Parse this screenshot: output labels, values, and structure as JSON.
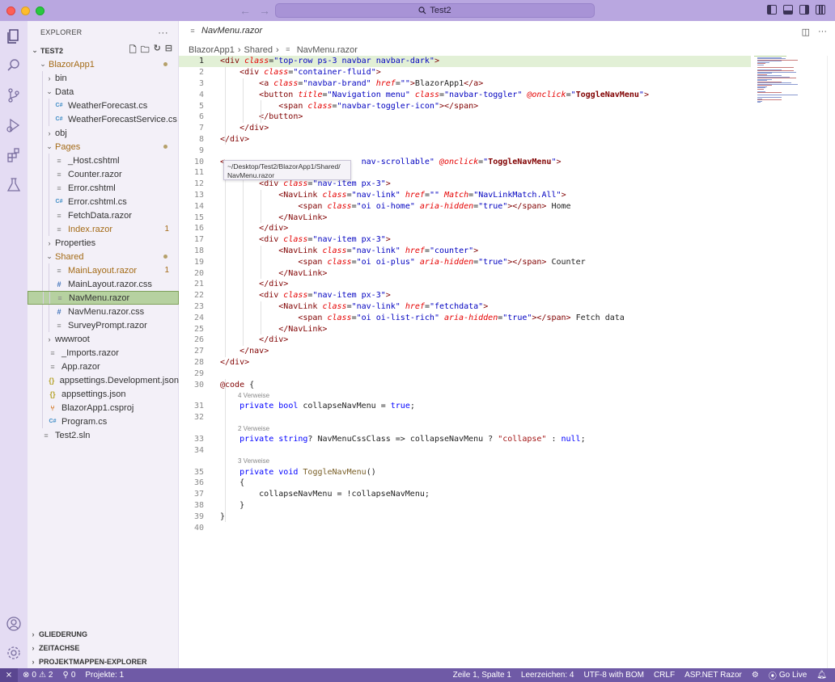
{
  "window": {
    "title": "Test2"
  },
  "activity_bar": {
    "items": [
      "explorer-icon",
      "search-icon",
      "source-control-icon",
      "run-debug-icon",
      "extensions-icon",
      "testing-icon"
    ],
    "bottom": [
      "account-icon",
      "settings-gear-icon"
    ]
  },
  "sidebar": {
    "title": "EXPLORER",
    "root": "TEST2",
    "tree": [
      {
        "label": "BlazorApp1",
        "type": "folder",
        "open": true,
        "depth": 1,
        "status": "dot",
        "mod": true
      },
      {
        "label": "bin",
        "type": "folder",
        "open": false,
        "depth": 2
      },
      {
        "label": "Data",
        "type": "folder",
        "open": true,
        "depth": 2
      },
      {
        "label": "WeatherForecast.cs",
        "type": "cs",
        "depth": 3
      },
      {
        "label": "WeatherForecastService.cs",
        "type": "cs",
        "depth": 3
      },
      {
        "label": "obj",
        "type": "folder",
        "open": false,
        "depth": 2
      },
      {
        "label": "Pages",
        "type": "folder",
        "open": true,
        "depth": 2,
        "status": "dot",
        "mod": true
      },
      {
        "label": "_Host.cshtml",
        "type": "razor",
        "depth": 3
      },
      {
        "label": "Counter.razor",
        "type": "razor",
        "depth": 3
      },
      {
        "label": "Error.cshtml",
        "type": "razor",
        "depth": 3
      },
      {
        "label": "Error.cshtml.cs",
        "type": "cs",
        "depth": 3
      },
      {
        "label": "FetchData.razor",
        "type": "razor",
        "depth": 3
      },
      {
        "label": "Index.razor",
        "type": "razor",
        "depth": 3,
        "badge": "1",
        "mod": true
      },
      {
        "label": "Properties",
        "type": "folder",
        "open": false,
        "depth": 2
      },
      {
        "label": "Shared",
        "type": "folder",
        "open": true,
        "depth": 2,
        "status": "dot",
        "mod": true
      },
      {
        "label": "MainLayout.razor",
        "type": "razor",
        "depth": 3,
        "badge": "1",
        "mod": true
      },
      {
        "label": "MainLayout.razor.css",
        "type": "css",
        "depth": 3
      },
      {
        "label": "NavMenu.razor",
        "type": "razor",
        "depth": 3,
        "selected": true
      },
      {
        "label": "NavMenu.razor.css",
        "type": "css",
        "depth": 3
      },
      {
        "label": "SurveyPrompt.razor",
        "type": "razor",
        "depth": 3
      },
      {
        "label": "wwwroot",
        "type": "folder",
        "open": false,
        "depth": 2
      },
      {
        "label": "_Imports.razor",
        "type": "razor",
        "depth": 2
      },
      {
        "label": "App.razor",
        "type": "razor",
        "depth": 2
      },
      {
        "label": "appsettings.Development.json",
        "type": "json",
        "depth": 2
      },
      {
        "label": "appsettings.json",
        "type": "json",
        "depth": 2
      },
      {
        "label": "BlazorApp1.csproj",
        "type": "proj",
        "depth": 2
      },
      {
        "label": "Program.cs",
        "type": "cs",
        "depth": 2
      },
      {
        "label": "Test2.sln",
        "type": "razor",
        "depth": 1
      }
    ],
    "footer_sections": [
      "GLIEDERUNG",
      "ZEITACHSE",
      "PROJEKTMAPPEN-EXPLORER"
    ]
  },
  "editor": {
    "tab_label": "NavMenu.razor",
    "breadcrumb": [
      "BlazorApp1",
      "Shared",
      "NavMenu.razor"
    ],
    "tooltip_line1": "~/Desktop/Test2/BlazorApp1/Shared/",
    "tooltip_line2": "NavMenu.razor",
    "codelens": [
      "4 Verweise",
      "2 Verweise",
      "3 Verweise"
    ],
    "line_numbers": [
      "1",
      "2",
      "3",
      "4",
      "5",
      "6",
      "7",
      "8",
      "9",
      "10",
      "11",
      "12",
      "13",
      "14",
      "15",
      "16",
      "17",
      "18",
      "19",
      "20",
      "21",
      "22",
      "23",
      "24",
      "25",
      "26",
      "27",
      "28",
      "29",
      "30",
      "31",
      "32",
      "33",
      "34",
      "35",
      "36",
      "37",
      "38",
      "39",
      "40"
    ]
  },
  "statusbar": {
    "errors": "0",
    "warnings": "2",
    "ports": "0",
    "projects": "Projekte: 1",
    "cursor": "Zeile 1, Spalte 1",
    "indent": "Leerzeichen: 4",
    "encoding": "UTF-8 with BOM",
    "eol": "CRLF",
    "language": "ASP.NET Razor",
    "golive": "Go Live"
  },
  "colors": {
    "titlebar": "#b9a7e0",
    "statusbar": "#6f5aa6",
    "selection": "#b6d1a0",
    "current_line": "#e2f0d6"
  }
}
